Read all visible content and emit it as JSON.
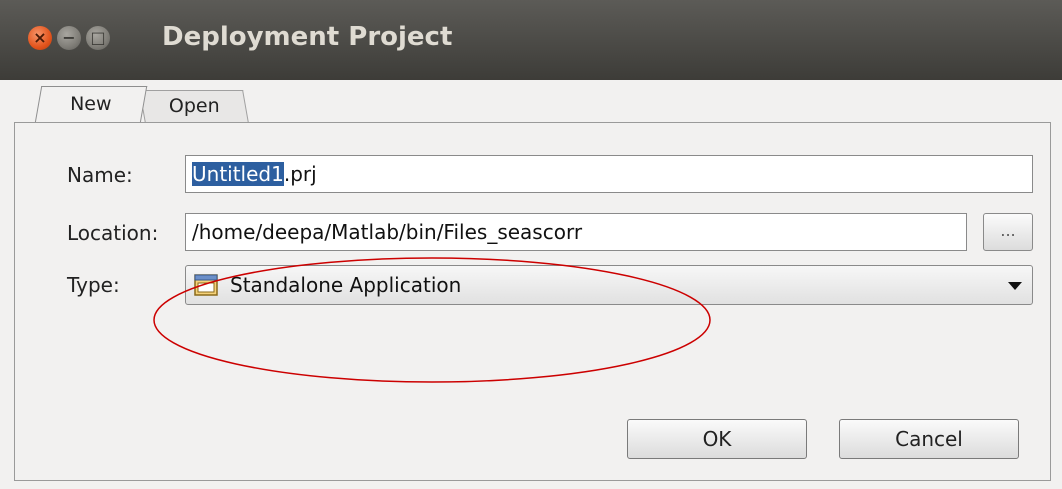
{
  "window": {
    "title": "Deployment Project",
    "controls": {
      "close_glyph": "×",
      "minimize_glyph": "−",
      "maximize_glyph": "□"
    }
  },
  "tabs": [
    {
      "label": "New",
      "active": true
    },
    {
      "label": "Open",
      "active": false
    }
  ],
  "form": {
    "name": {
      "label": "Name:",
      "value_selected": "Untitled1",
      "value_rest": ".prj"
    },
    "location": {
      "label": "Location:",
      "value": "/home/deepa/Matlab/bin/Files_seascorr",
      "browse_label": "..."
    },
    "type": {
      "label": "Type:",
      "selected": "Standalone Application",
      "icon": "window-app-icon"
    }
  },
  "buttons": {
    "ok": "OK",
    "cancel": "Cancel"
  },
  "colors": {
    "titlebar": "#3d3c38",
    "close_button": "#e3541c",
    "selection": "#2d5fa0",
    "annotation_ellipse": "#cc0000"
  }
}
